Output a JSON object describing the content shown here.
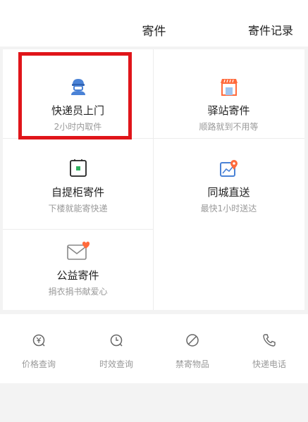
{
  "header": {
    "title": "寄件",
    "record_label": "寄件记录"
  },
  "services": [
    {
      "label": "快递员上门",
      "sub": "2小时内取件",
      "icon": "courier-icon"
    },
    {
      "label": "驿站寄件",
      "sub": "顺路就到不用等",
      "icon": "station-icon"
    },
    {
      "label": "自提柜寄件",
      "sub": "下楼就能寄快递",
      "icon": "locker-icon"
    },
    {
      "label": "同城直送",
      "sub": "最快1小时送达",
      "icon": "map-pin-icon"
    },
    {
      "label": "公益寄件",
      "sub": "捐衣捐书献爱心",
      "icon": "heart-envelope-icon"
    }
  ],
  "tools": [
    {
      "label": "价格查询",
      "icon": "price-icon"
    },
    {
      "label": "时效查询",
      "icon": "clock-icon"
    },
    {
      "label": "禁寄物品",
      "icon": "forbidden-icon"
    },
    {
      "label": "快递电话",
      "icon": "phone-icon"
    }
  ],
  "colors": {
    "accent": "#ff6a3c",
    "highlight": "#e0151a",
    "courier": "#4a82d6"
  }
}
